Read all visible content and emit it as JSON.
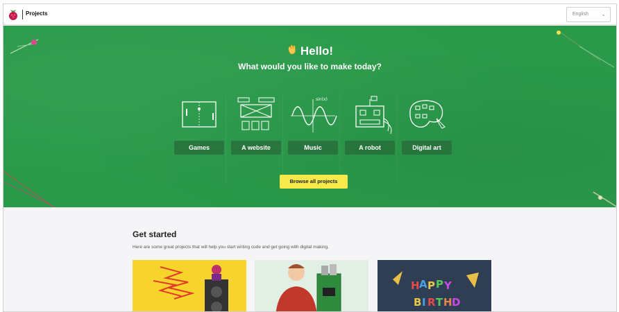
{
  "header": {
    "brand": "Projects",
    "language": "English",
    "logo": "raspberry-pi-logo"
  },
  "hero": {
    "greeting": "Hello!",
    "question": "What would you like to make today?",
    "categories": [
      {
        "label": "Games",
        "icon": "games-icon"
      },
      {
        "label": "A website",
        "icon": "website-icon"
      },
      {
        "label": "Music",
        "icon": "music-icon"
      },
      {
        "label": "A robot",
        "icon": "robot-icon"
      },
      {
        "label": "Digital art",
        "icon": "digital-art-icon"
      }
    ],
    "browse_button": "Browse all projects",
    "colors": {
      "background": "#2a9a4a",
      "button": "#f6e94a"
    }
  },
  "get_started": {
    "title": "Get started",
    "description": "Here are some great projects that will help you start writing code and get going with digital making.",
    "cards": [
      {
        "image": "rock-band-illustration",
        "color": "#f7d42c"
      },
      {
        "image": "maker-with-board-illustration",
        "color": "#e1efe4"
      },
      {
        "image": "happy-birthday-illustration",
        "color": "#2f3e52"
      }
    ]
  }
}
